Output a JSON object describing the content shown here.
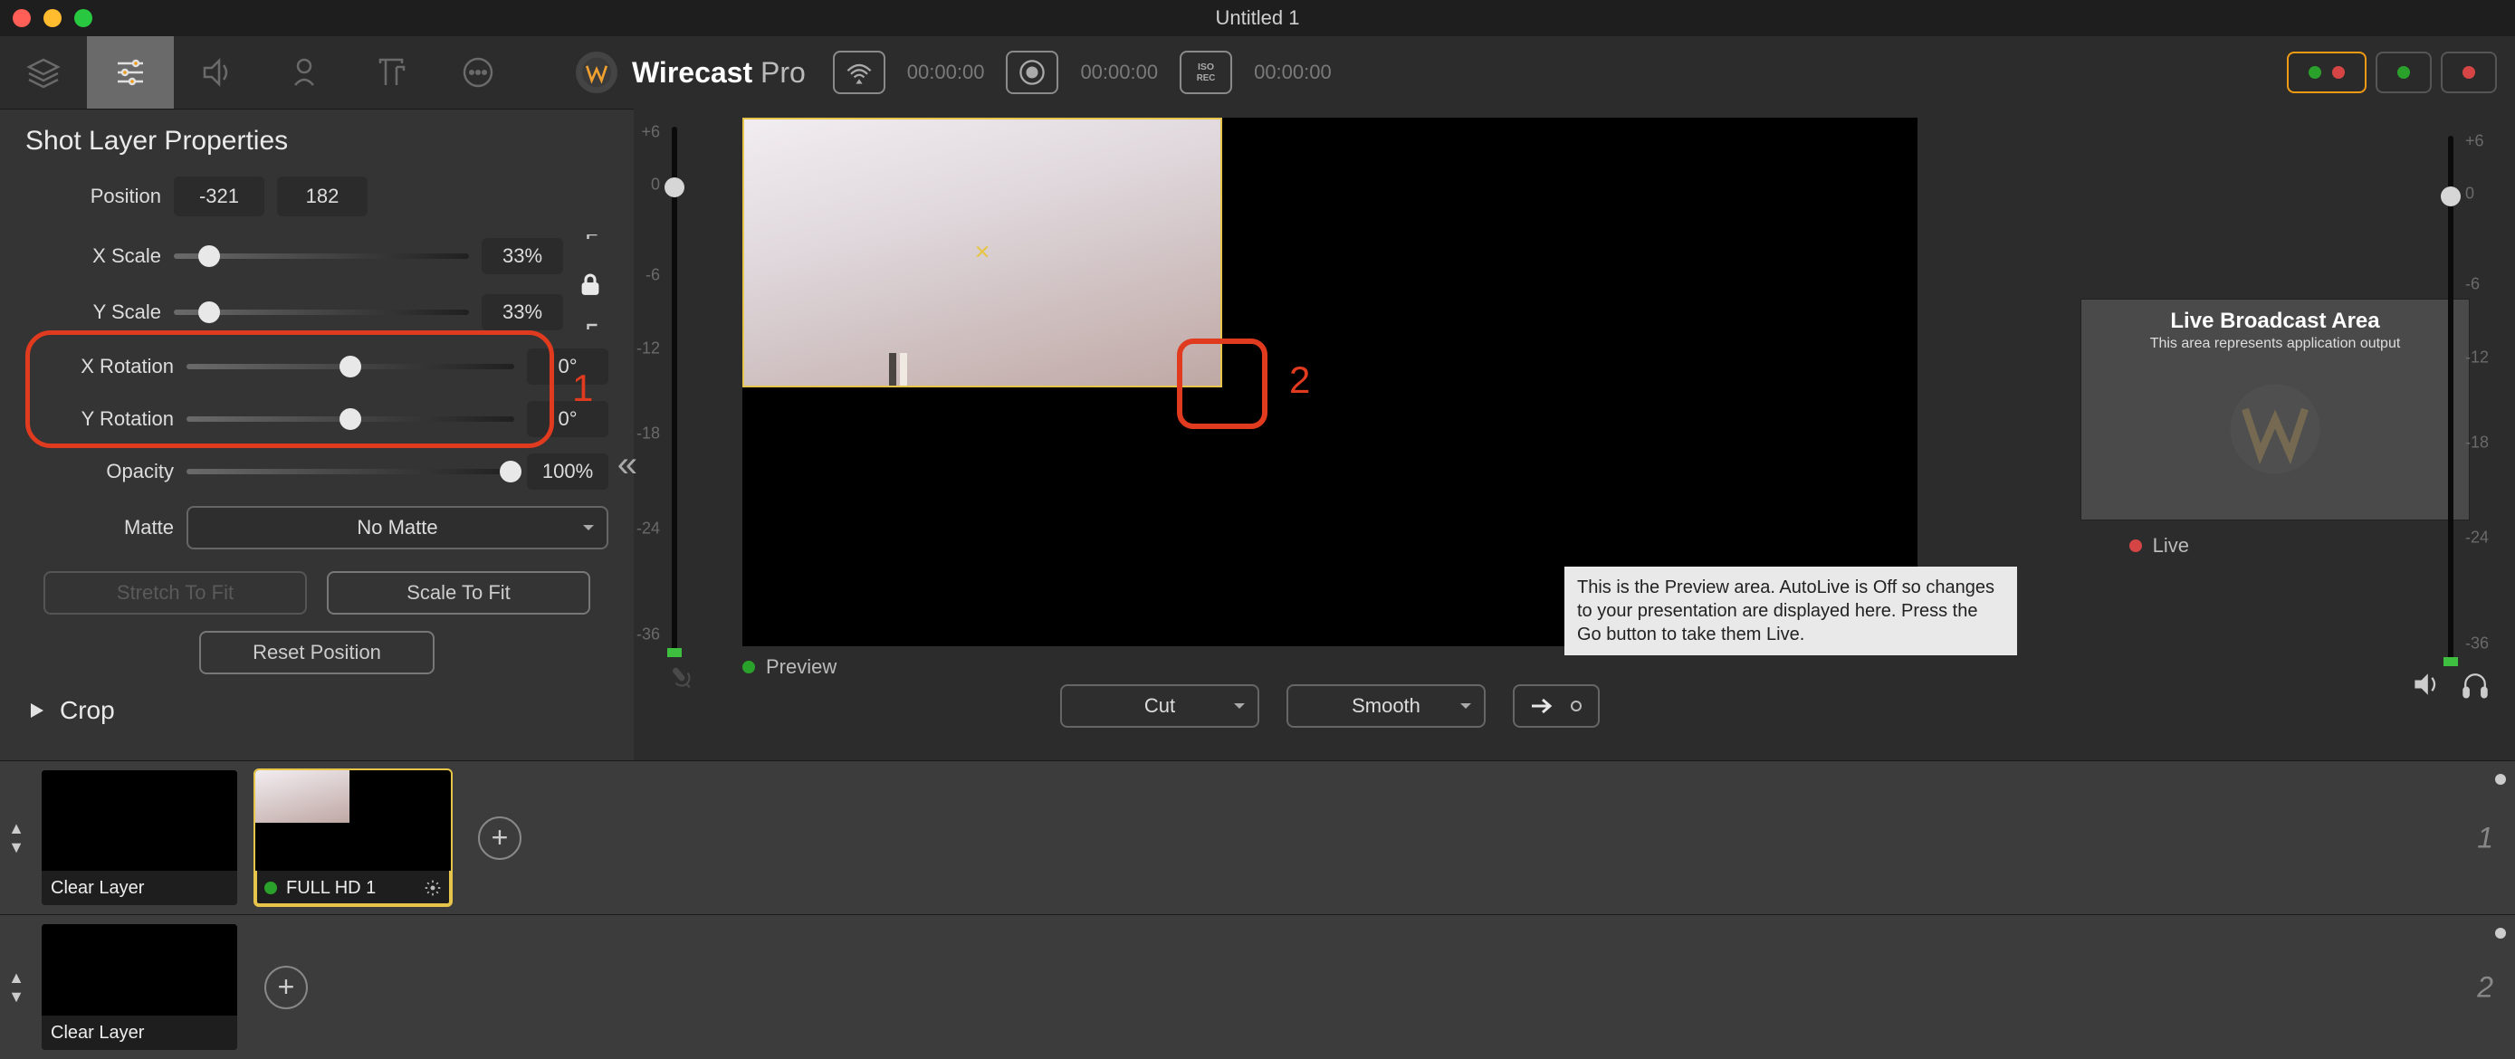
{
  "window": {
    "title": "Untitled 1"
  },
  "brand": {
    "name": "Wirecast",
    "suffix": "Pro"
  },
  "timecodes": {
    "stream": "00:00:00",
    "record": "00:00:00",
    "iso": "00:00:00"
  },
  "panel": {
    "title": "Shot Layer Properties",
    "position_label": "Position",
    "pos_x": "-321",
    "pos_y": "182",
    "xscale_label": "X Scale",
    "xscale_val": "33%",
    "yscale_label": "Y Scale",
    "yscale_val": "33%",
    "xrot_label": "X Rotation",
    "xrot_val": "0°",
    "yrot_label": "Y Rotation",
    "yrot_val": "0°",
    "opacity_label": "Opacity",
    "opacity_val": "100%",
    "matte_label": "Matte",
    "matte_val": "No Matte",
    "stretch_btn": "Stretch To Fit",
    "scale_btn": "Scale To Fit",
    "reset_btn": "Reset Position",
    "crop_section": "Crop"
  },
  "annotations": {
    "one": "1",
    "two": "2"
  },
  "preview": {
    "label": "Preview",
    "tooltip": "This is the Preview area.  AutoLive is Off so changes to your presentation are displayed here.  Press the Go button to take them Live."
  },
  "live": {
    "card_title": "Live Broadcast Area",
    "card_sub": "This area represents application output",
    "label": "Live"
  },
  "meter_ticks": [
    "+6",
    "0",
    "-6",
    "-12",
    "-18",
    "-24",
    "-36"
  ],
  "transition": {
    "cut": "Cut",
    "smooth": "Smooth"
  },
  "layers": {
    "clear": "Clear Layer",
    "shot1": "FULL HD 1",
    "num1": "1",
    "num2": "2"
  }
}
